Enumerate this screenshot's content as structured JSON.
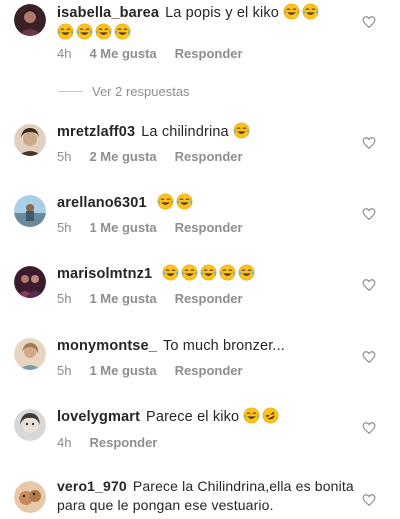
{
  "comments": [
    {
      "username": "isabella_barea",
      "text": "La popis y el kiko",
      "emoji_count": 6,
      "time": "4h",
      "likes": "4 Me gusta",
      "reply": "Responder",
      "avatar_colors": [
        "#6b3a4a",
        "#2a1b1f"
      ]
    },
    {
      "username": "mretzlaff03",
      "text": "La chilindrina",
      "emoji_count": 1,
      "time": "5h",
      "likes": "2 Me gusta",
      "reply": "Responder",
      "avatar_colors": [
        "#c9a98a",
        "#4a3428"
      ]
    },
    {
      "username": "arellano6301",
      "text": "",
      "emoji_count": 2,
      "time": "5h",
      "likes": "1 Me gusta",
      "reply": "Responder",
      "avatar_colors": [
        "#9cc7e0",
        "#3d5a6b"
      ]
    },
    {
      "username": "marisolmtnz1",
      "text": "",
      "emoji_count": 5,
      "time": "5h",
      "likes": "1 Me gusta",
      "reply": "Responder",
      "avatar_colors": [
        "#8a3a5a",
        "#3a1c2c"
      ]
    },
    {
      "username": "monymontse_",
      "text": "To much bronzer...",
      "emoji_count": 0,
      "time": "5h",
      "likes": "1 Me gusta",
      "reply": "Responder",
      "avatar_colors": [
        "#e8d5c0",
        "#a07a5a"
      ]
    },
    {
      "username": "lovelygmart",
      "text": "Parece el kiko",
      "emoji_count": 2,
      "time": "4h",
      "likes": "",
      "reply": "Responder",
      "avatar_colors": [
        "#d8d8d8",
        "#5a5a5a"
      ]
    },
    {
      "username": "vero1_970",
      "text": "Parece la Chilindrina,ella es bonita para que le pongan ese vestuario.",
      "emoji_count": 0,
      "time": "",
      "likes": "",
      "reply": "",
      "avatar_colors": [
        "#c98a5a",
        "#6a4a2a"
      ]
    }
  ],
  "view_replies": "Ver 2 respuestas",
  "icons": {
    "heart": "heart-outline-icon",
    "emoji": "face-with-tears-of-joy-icon"
  },
  "colors": {
    "text": "#262626",
    "meta": "#8e8e8e",
    "emoji_face": "#fcc21b"
  }
}
